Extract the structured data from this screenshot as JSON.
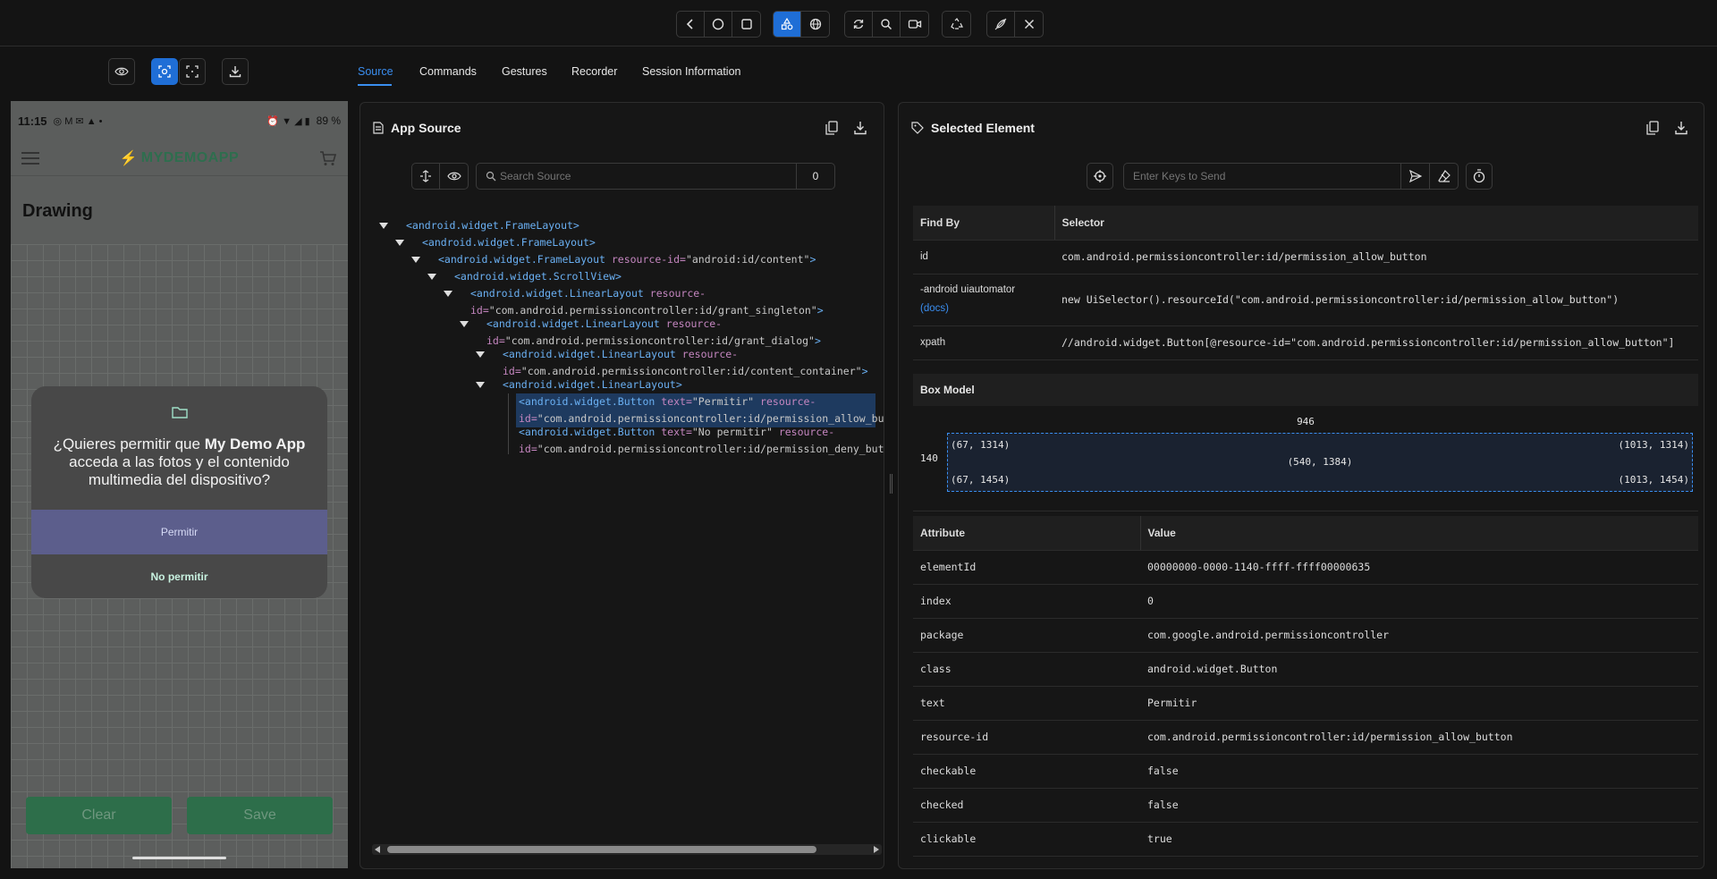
{
  "toolbar": {
    "buttons": [
      "back-icon",
      "home-icon",
      "app-switch-icon",
      "select-elements-icon",
      "web-icon",
      "refresh-icon",
      "search-icon",
      "record-icon",
      "recycle-icon",
      "quit-rocket-icon",
      "close-icon"
    ]
  },
  "device_toolbar": {
    "buttons": [
      "show-hide-icon",
      "select-element-icon",
      "tap-coordinates-icon",
      "download-screenshot-icon"
    ]
  },
  "tabs": [
    {
      "label": "Source"
    },
    {
      "label": "Commands"
    },
    {
      "label": "Gestures"
    },
    {
      "label": "Recorder"
    },
    {
      "label": "Session Information"
    }
  ],
  "device": {
    "time": "11:15",
    "battery": "89 %",
    "app_logo": "MYDEMOAPP",
    "page_title": "Drawing",
    "dialog": {
      "question_pre": "¿Quieres permitir que ",
      "question_bold": "My Demo App",
      "question_post": " acceda a las fotos y el contenido multimedia del dispositivo?",
      "allow": "Permitir",
      "deny": "No permitir"
    },
    "clear": "Clear",
    "save": "Save"
  },
  "source": {
    "title": "App Source",
    "search_placeholder": "Search Source",
    "search_count": "0",
    "tree": [
      {
        "tag": "<android.widget.FrameLayout>",
        "a": "",
        "v": "",
        "l2": ""
      },
      {
        "tag": "<android.widget.FrameLayout>",
        "a": "",
        "v": "",
        "l2": ""
      },
      {
        "tag": "<android.widget.FrameLayout",
        "a": " resource-id=",
        "v": "\"android:id/content\"",
        "end": ">",
        "l2": ""
      },
      {
        "tag": "<android.widget.ScrollView>",
        "a": "",
        "v": "",
        "l2": ""
      },
      {
        "tag": "<android.widget.LinearLayout",
        "a": " resource-",
        "v": "",
        "l2a": "id=",
        "l2v": "\"com.android.permissioncontroller:id/grant_singleton\"",
        "l2e": ">"
      },
      {
        "tag": "<android.widget.LinearLayout",
        "a": " resource-",
        "v": "",
        "l2a": "id=",
        "l2v": "\"com.android.permissioncontroller:id/grant_dialog\"",
        "l2e": ">"
      },
      {
        "tag": "<android.widget.LinearLayout",
        "a": " resource-",
        "v": "",
        "l2a": "id=",
        "l2v": "\"com.android.permissioncontroller:id/content_container\"",
        "l2e": ">"
      },
      {
        "tag": "<android.widget.LinearLayout>",
        "a": "",
        "v": "",
        "l2": ""
      },
      {
        "tag": "<android.widget.Button",
        "a": " text=",
        "v": "\"Permitir\"",
        "a2": " resource-",
        "l2a": "id=",
        "l2v": "\"com.android.permissioncontroller:id/permission_allow_butt",
        "l2e": ""
      },
      {
        "tag": "<android.widget.Button",
        "a": " text=",
        "v": "\"No permitir\"",
        "a2": " resource-",
        "l2a": "id=",
        "l2v": "\"com.android.permissioncontroller:id/permission_deny_butt",
        "l2e": ""
      }
    ]
  },
  "selected": {
    "title": "Selected Element",
    "keys_placeholder": "Enter Keys to Send",
    "find_by_header": "Find By",
    "selector_header": "Selector",
    "selectors": [
      {
        "by": "id",
        "sel": "com.android.permissioncontroller:id/permission_allow_button"
      },
      {
        "by": "-android uiautomator",
        "docs": "(docs)",
        "sel": "new UiSelector().resourceId(\"com.android.permissioncontroller:id/permission_allow_button\")"
      },
      {
        "by": "xpath",
        "sel": "//android.widget.Button[@resource-id=\"com.android.permissioncontroller:id/permission_allow_button\"]"
      }
    ],
    "box_model_header": "Box Model",
    "box": {
      "width": "946",
      "height": "140",
      "tl": "(67, 1314)",
      "tr": "(1013, 1314)",
      "center": "(540, 1384)",
      "bl": "(67, 1454)",
      "br": "(1013, 1454)"
    },
    "attr_header": "Attribute",
    "value_header": "Value",
    "attributes": [
      {
        "k": "elementId",
        "v": "00000000-0000-1140-ffff-ffff00000635"
      },
      {
        "k": "index",
        "v": "0"
      },
      {
        "k": "package",
        "v": "com.google.android.permissioncontroller"
      },
      {
        "k": "class",
        "v": "android.widget.Button"
      },
      {
        "k": "text",
        "v": "Permitir"
      },
      {
        "k": "resource-id",
        "v": "com.android.permissioncontroller:id/permission_allow_button"
      },
      {
        "k": "checkable",
        "v": "false"
      },
      {
        "k": "checked",
        "v": "false"
      },
      {
        "k": "clickable",
        "v": "true"
      }
    ]
  },
  "colors": {
    "accent": "#1f6ed6",
    "selected_row": "#1e3a5f",
    "dialog_allow": "#5c5e8c",
    "tag": "#6ab0f3",
    "attr": "#c586c0"
  }
}
